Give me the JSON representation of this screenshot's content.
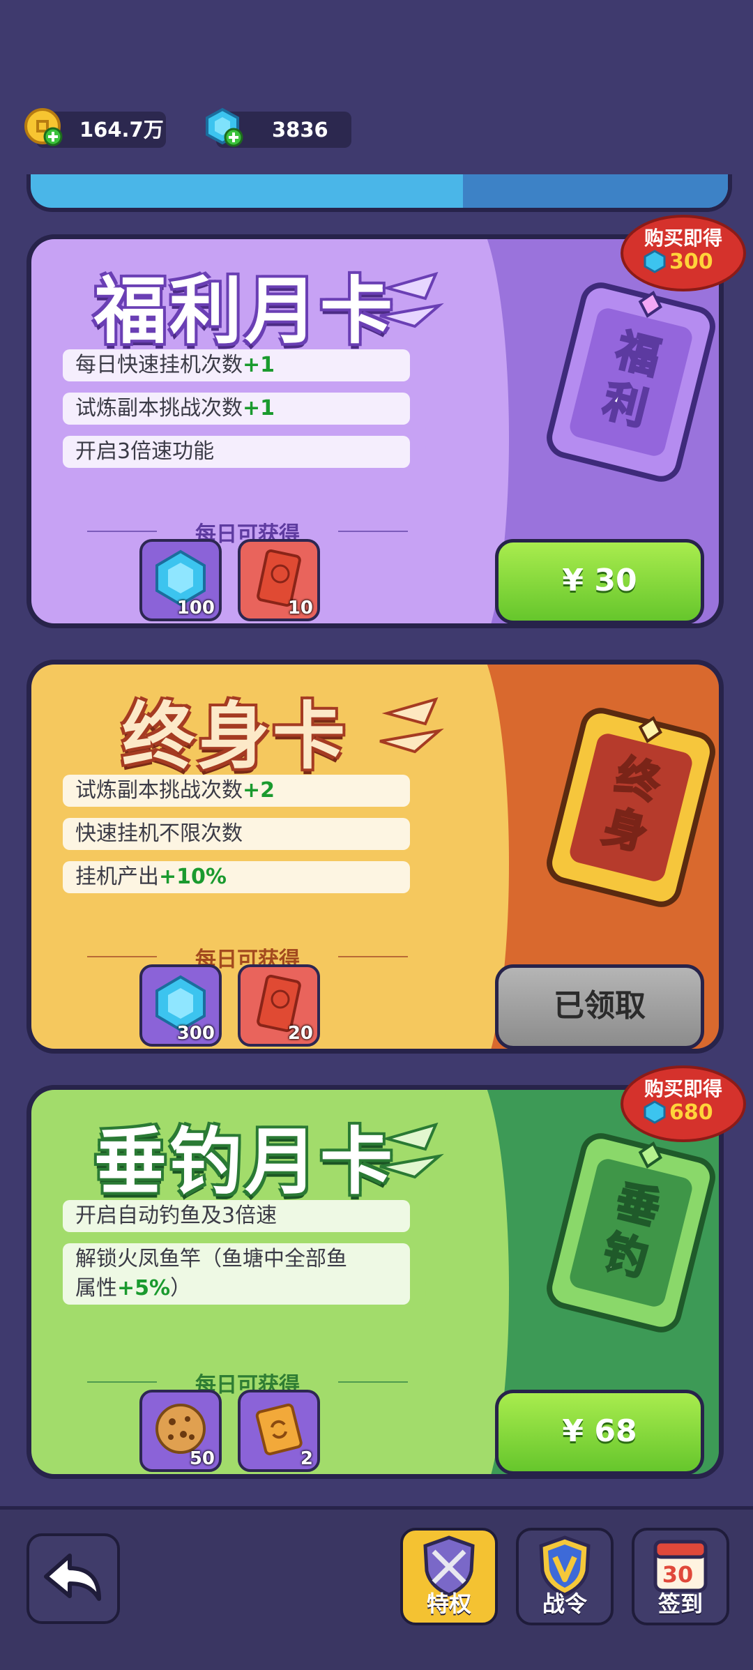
{
  "resources": {
    "coins": "164.7万",
    "gems": "3836"
  },
  "cards": [
    {
      "title": "福利月卡",
      "card_art_text": [
        "福",
        "利"
      ],
      "features": [
        {
          "text": "每日快速挂机次数",
          "bonus": "+1"
        },
        {
          "text": "试炼副本挑战次数",
          "bonus": "+1"
        },
        {
          "text": "开启3倍速功能",
          "bonus": ""
        }
      ],
      "daily_label": "每日可获得",
      "rewards": [
        {
          "icon": "gem-icon",
          "qty": "100"
        },
        {
          "icon": "ticket-icon",
          "qty": "10"
        }
      ],
      "button_label": "¥ 30",
      "badge": {
        "label": "购买即得",
        "amount": "300"
      }
    },
    {
      "title": "终身卡",
      "card_art_text": [
        "终",
        "身"
      ],
      "features": [
        {
          "text": "试炼副本挑战次数",
          "bonus": "+2"
        },
        {
          "text": "快速挂机不限次数",
          "bonus": ""
        },
        {
          "text": "挂机产出",
          "bonus": "+10%"
        }
      ],
      "daily_label": "每日可获得",
      "rewards": [
        {
          "icon": "gem-icon",
          "qty": "300"
        },
        {
          "icon": "ticket-icon",
          "qty": "20"
        }
      ],
      "button_label": "已领取"
    },
    {
      "title": "垂钓月卡",
      "card_art_text": [
        "垂",
        "钓"
      ],
      "features": [
        {
          "text": "开启自动钓鱼及3倍速",
          "bonus": ""
        },
        {
          "text": "解锁火凤鱼竿（鱼塘中全部鱼",
          "line2": "属性",
          "bonus": "+5%",
          "tail": "）"
        }
      ],
      "daily_label": "每日可获得",
      "rewards": [
        {
          "icon": "cookie-icon",
          "qty": "50"
        },
        {
          "icon": "golden-ticket-icon",
          "qty": "2"
        }
      ],
      "button_label": "¥ 68",
      "badge": {
        "label": "购买即得",
        "amount": "680"
      }
    }
  ],
  "nav": {
    "privilege": "特权",
    "battle_pass": "战令",
    "checkin": "签到",
    "checkin_day": "30"
  },
  "colors": {
    "background": "#3f3a6e",
    "welfare": "#c29bf0",
    "lifetime": "#f2c25a",
    "fishing": "#9cd867",
    "buy_button": "#7ad03a"
  }
}
